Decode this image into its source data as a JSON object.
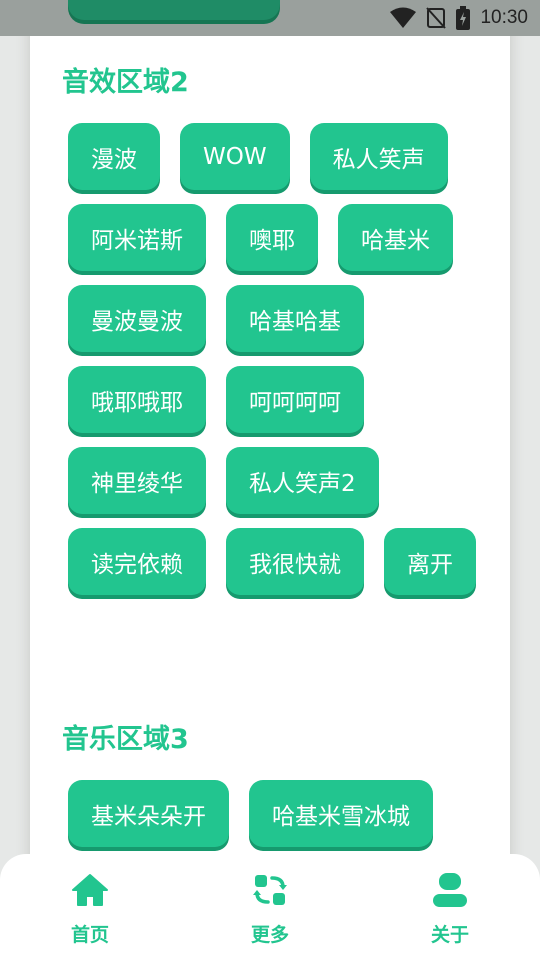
{
  "status": {
    "time": "10:30"
  },
  "colors": {
    "accent": "#22c58f",
    "accent_dark": "#169a6e"
  },
  "sections": [
    {
      "title": "音效区域2",
      "buttons": [
        "漫波",
        "WOW",
        "私人笑声",
        "阿米诺斯",
        "噢耶",
        "哈基米",
        "曼波曼波",
        "哈基哈基",
        "哦耶哦耶",
        "呵呵呵呵",
        "神里绫华",
        "私人笑声2",
        "读完依赖",
        "我很快就",
        "离开"
      ]
    },
    {
      "title": "音乐区域3",
      "buttons": [
        "基米朵朵开",
        "哈基米雪冰城"
      ]
    }
  ],
  "nav": [
    {
      "label": "首页",
      "icon": "home-icon"
    },
    {
      "label": "更多",
      "icon": "refresh-icon"
    },
    {
      "label": "关于",
      "icon": "user-icon"
    }
  ]
}
